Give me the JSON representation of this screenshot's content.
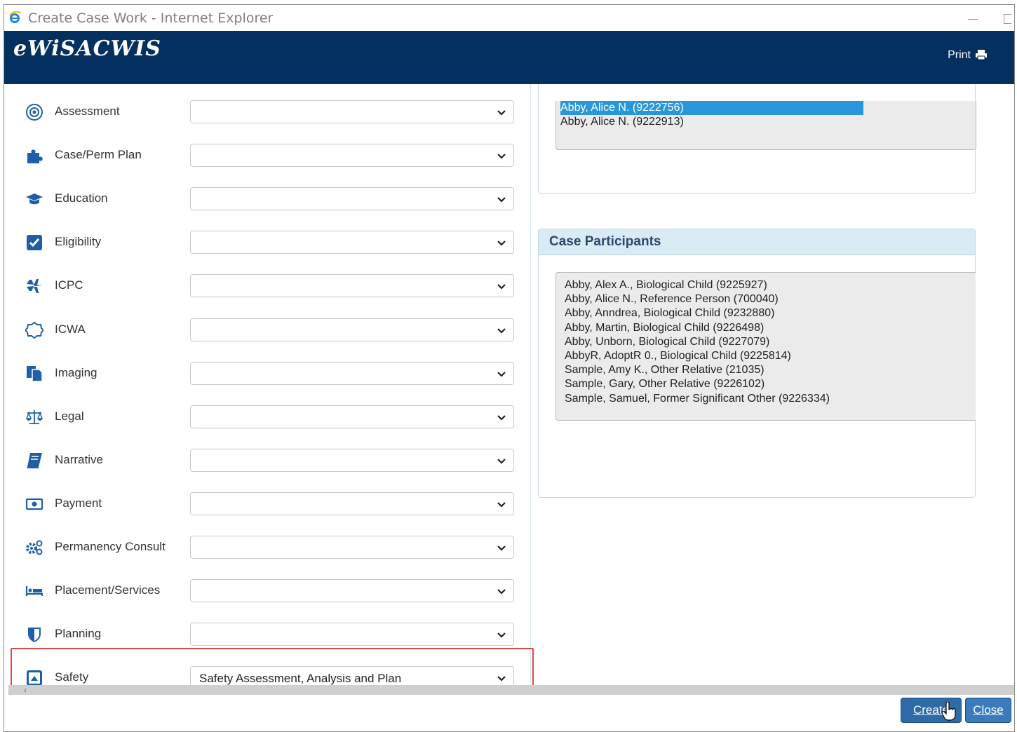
{
  "window": {
    "title": "Create Case Work - Internet Explorer"
  },
  "header": {
    "app_title": "eWiSACWIS",
    "print_label": "Print"
  },
  "work_items": [
    {
      "label": "Assessment",
      "icon": "target-icon",
      "value": ""
    },
    {
      "label": "Case/Perm Plan",
      "icon": "puzzle-icon",
      "value": ""
    },
    {
      "label": "Education",
      "icon": "graduation-cap-icon",
      "value": ""
    },
    {
      "label": "Eligibility",
      "icon": "checkbox-icon",
      "value": ""
    },
    {
      "label": "ICPC",
      "icon": "airplane-icon",
      "value": ""
    },
    {
      "label": "ICWA",
      "icon": "circle-outline-icon",
      "value": ""
    },
    {
      "label": "Imaging",
      "icon": "copy-documents-icon",
      "value": ""
    },
    {
      "label": "Legal",
      "icon": "scales-icon",
      "value": ""
    },
    {
      "label": "Narrative",
      "icon": "book-icon",
      "value": ""
    },
    {
      "label": "Payment",
      "icon": "money-bill-icon",
      "value": ""
    },
    {
      "label": "Permanency Consult",
      "icon": "cogs-icon",
      "value": ""
    },
    {
      "label": "Placement/Services",
      "icon": "bed-icon",
      "value": ""
    },
    {
      "label": "Planning",
      "icon": "shield-icon",
      "value": ""
    },
    {
      "label": "Safety",
      "icon": "caret-square-up-icon",
      "value": "Safety Assessment, Analysis and Plan"
    }
  ],
  "focus_list": {
    "items": [
      "Abby, Alice N. (9222756)",
      "Abby, Alice N. (9222913)"
    ],
    "selected_index": 0
  },
  "case_participants": {
    "title": "Case Participants",
    "items": [
      "Abby, Alex A., Biological Child (9225927)",
      "Abby, Alice N., Reference Person (700040)",
      "Abby, Anndrea, Biological Child (9232880)",
      "Abby, Martin, Biological Child (9226498)",
      "Abby, Unborn, Biological Child (9227079)",
      "AbbyR, AdoptR 0., Biological Child (9225814)",
      "Sample, Amy K., Other Relative (21035)",
      "Sample, Gary, Other Relative (9226102)",
      "Sample, Samuel, Former Significant Other (9226334)"
    ]
  },
  "buttons": {
    "create": "Create",
    "close": "Close"
  },
  "colors": {
    "header_bg": "#03305e",
    "selected_bg": "#2996d9",
    "button_bg": "#2d6aa8",
    "highlight": "#e04848"
  }
}
